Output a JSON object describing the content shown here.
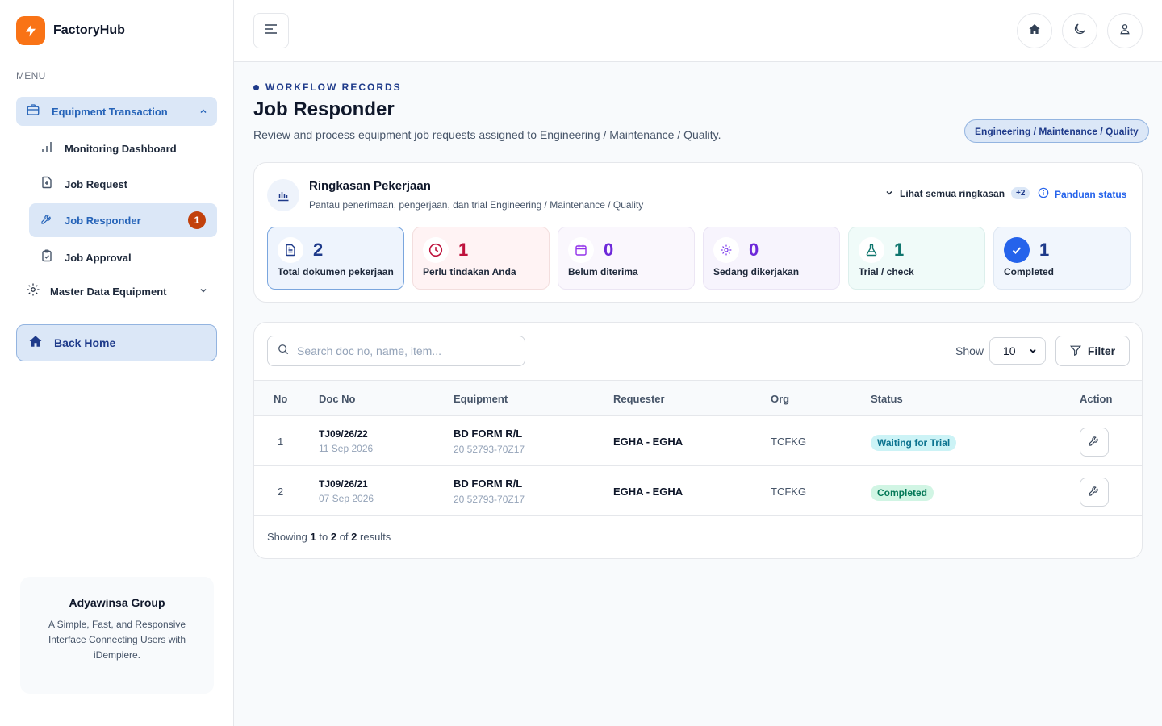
{
  "brand": {
    "name": "FactoryHub"
  },
  "sidebar": {
    "menu_label": "MENU",
    "group": {
      "label": "Equipment Transaction"
    },
    "items": [
      {
        "label": "Monitoring Dashboard"
      },
      {
        "label": "Job Request"
      },
      {
        "label": "Job Responder",
        "badge": "1"
      },
      {
        "label": "Job Approval"
      }
    ],
    "master": {
      "label": "Master Data Equipment"
    },
    "back_home": "Back Home",
    "company": {
      "name": "Adyawinsa Group",
      "desc": "A Simple, Fast, and Responsive Interface Connecting Users with iDempiere."
    }
  },
  "header": {
    "eyebrow": "WORKFLOW RECORDS",
    "title": "Job Responder",
    "subtitle": "Review and process equipment job requests assigned to Engineering / Maintenance / Quality.",
    "org_pill": "Engineering / Maintenance / Quality"
  },
  "summary": {
    "title": "Ringkasan Pekerjaan",
    "subtitle": "Pantau penerimaan, pengerjaan, dan trial Engineering / Maintenance / Quality",
    "see_all": "Lihat semua ringkasan",
    "see_all_badge": "+2",
    "guide": "Panduan status",
    "stats": [
      {
        "value": "2",
        "label": "Total dokumen pekerjaan",
        "color": "#1e3a8a",
        "bg": "#eef4fd",
        "border": "#7aa6de",
        "icon": "document-icon"
      },
      {
        "value": "1",
        "label": "Perlu tindakan Anda",
        "color": "#be123c",
        "bg": "#fff3f4",
        "border": "#f3dede",
        "icon": "clock-icon"
      },
      {
        "value": "0",
        "label": "Belum diterima",
        "color": "#6d28d9",
        "bg": "#faf7fd",
        "border": "#ece6f4",
        "icon": "calendar-icon"
      },
      {
        "value": "0",
        "label": "Sedang dikerjakan",
        "color": "#6d28d9",
        "bg": "#f7f4fd",
        "border": "#ebe5f5",
        "icon": "gear-icon"
      },
      {
        "value": "1",
        "label": "Trial / check",
        "color": "#0f766e",
        "bg": "#f0fbf9",
        "border": "#dcefec",
        "icon": "flask-icon"
      },
      {
        "value": "1",
        "label": "Completed",
        "color": "#1e3a8a",
        "bg": "#f1f6fd",
        "border": "#dfe8f3",
        "icon": "check-icon"
      }
    ]
  },
  "table": {
    "search_placeholder": "Search doc no, name, item...",
    "show_label": "Show",
    "show_value": "10",
    "filter_label": "Filter",
    "columns": [
      "No",
      "Doc No",
      "Equipment",
      "Requester",
      "Org",
      "Status",
      "Action"
    ],
    "rows": [
      {
        "no": "1",
        "doc_no": "TJ09/26/22",
        "date": "11 Sep 2026",
        "equipment": "BD FORM R/L",
        "equipment_code": "20 52793-70Z17",
        "requester": "EGHA - EGHA",
        "org": "TCFKG",
        "status": "Waiting for Trial",
        "status_color": "#0e7490",
        "status_bg": "#ccf3f6"
      },
      {
        "no": "2",
        "doc_no": "TJ09/26/21",
        "date": "07 Sep 2026",
        "equipment": "BD FORM R/L",
        "equipment_code": "20 52793-70Z17",
        "requester": "EGHA - EGHA",
        "org": "TCFKG",
        "status": "Completed",
        "status_color": "#047857",
        "status_bg": "#d1f5e4"
      }
    ],
    "footer": {
      "prefix": "Showing",
      "from": "1",
      "to_word": "to",
      "to": "2",
      "of_word": "of",
      "total": "2",
      "suffix": "results"
    }
  }
}
